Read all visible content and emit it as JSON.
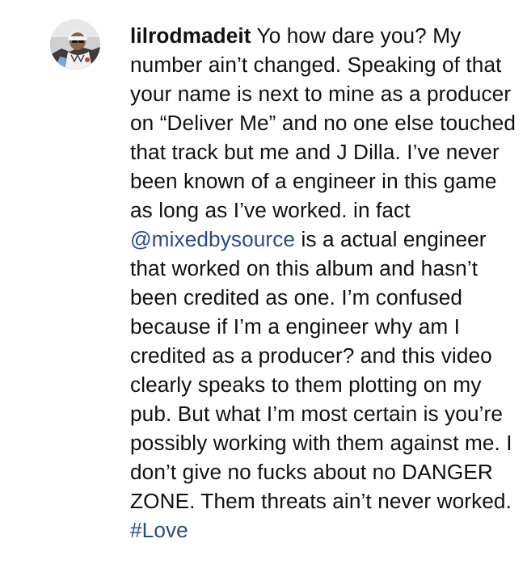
{
  "comment": {
    "username": "lilrodmadeit",
    "text_part1": "Yo how dare you? My number ain’t changed. Speaking of that your name is next to mine as a producer on “Deliver Me” and no one else touched that track but me and J Dilla. I’ve never been known of a engineer in this game as long as I’ve worked. in fact ",
    "mention": "@mixedbysource",
    "text_part2": " is a actual engineer that worked on this album and hasn’t been credited as one. I’m confused because if I’m a engineer why am I credited as a producer? and this video clearly speaks to them plotting on my pub. But what I’m most certain is you’re possibly working with them against me. I don’t give no fucks about no DANGER ZONE. Them threats ain’t never worked. ",
    "hashtag": "#Love"
  },
  "colors": {
    "text": "#111111",
    "link": "#2a4a8e",
    "background": "#ffffff"
  },
  "icons": {
    "avatar": "user-avatar-photo"
  }
}
